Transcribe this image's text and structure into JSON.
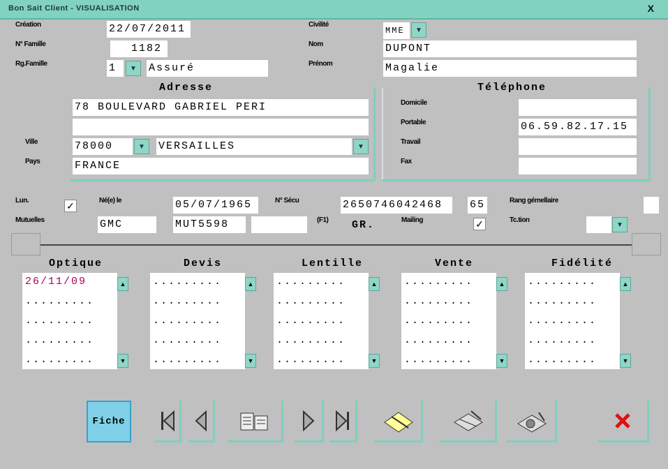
{
  "window": {
    "title": "Bon Sait Client - VISUALISATION",
    "close_glyph": "X"
  },
  "identity": {
    "creation_label": "Création",
    "creation_value": "22/07/2011",
    "famille_label": "N° Famille",
    "famille_value": "1182",
    "rgfamille_label": "Rg.Famille",
    "rgfamille_value": "1",
    "rgfamille_type": "Assuré",
    "civilite_label": "Civilité",
    "civilite_value": "MME",
    "nom_label": "Nom",
    "nom_value": "DUPONT",
    "prenom_label": "Prénom",
    "prenom_value": "Magalie"
  },
  "adresse": {
    "title": "Adresse",
    "line1": "78 BOULEVARD GABRIEL PERI",
    "line2": "",
    "ville_label": "Ville",
    "cp_value": "78000",
    "ville_value": "VERSAILLES",
    "pays_label": "Pays",
    "pays_value": "FRANCE"
  },
  "telephone": {
    "title": "Téléphone",
    "domicile_label": "Domicile",
    "domicile_value": "",
    "portable_label": "Portable",
    "portable_value": "06.59.82.17.15",
    "travail_label": "Travail",
    "travail_value": "",
    "fax_label": "Fax",
    "fax_value": ""
  },
  "details": {
    "lun_label": "Lun.",
    "lun_checked": "✓",
    "nele_label": "Né(e) le",
    "nele_value": "05/07/1965",
    "nsecu_label": "N° Sécu",
    "nsecu_value": "2650746042468",
    "nsecu_key": "65",
    "rang_label": "Rang gémellaire",
    "mutuelles_label": "Mutuelles",
    "mut1": "GMC",
    "mut2": "MUT5598",
    "mut3": "",
    "f1_label": "(F1)",
    "gr_label": "GR.",
    "mailing_label": "Mailing",
    "mailing_checked": "✓",
    "tction_label": "Tc.tion"
  },
  "history": {
    "columns": [
      {
        "title": "Optique",
        "first": "26/11/09"
      },
      {
        "title": "Devis",
        "first": "........."
      },
      {
        "title": "Lentille",
        "first": "........."
      },
      {
        "title": "Vente",
        "first": "........."
      },
      {
        "title": "Fidélité",
        "first": "........."
      }
    ],
    "empty_line": "........."
  },
  "toolbar": {
    "first_label": "Fiche",
    "icons": [
      "first-record-icon",
      "prev-record-icon",
      "list-view-icon",
      "next-record-icon",
      "last-record-icon",
      "edit-icon",
      "print-icon",
      "stats-icon",
      "exit-icon"
    ]
  }
}
